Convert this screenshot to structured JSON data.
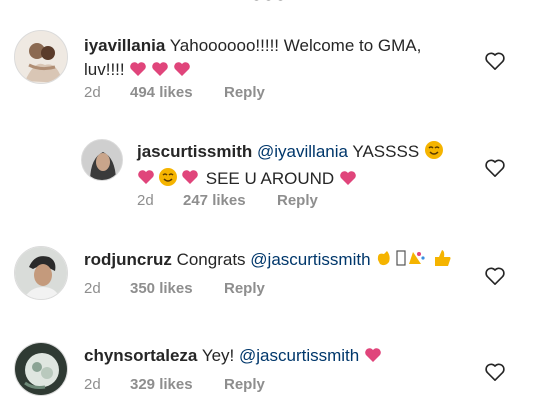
{
  "comments": [
    {
      "username": "iyavillania",
      "text_line1": "Yahoooooo!!!!! Welcome to GMA,",
      "text_line2": "luv!!!!",
      "time": "2d",
      "likes": "494 likes",
      "reply": "Reply"
    },
    {
      "username": "jascurtissmith",
      "mention": "@iyavillania",
      "text_line1": "YASSSS",
      "text_line2": "SEE U AROUND",
      "time": "2d",
      "likes": "247 likes",
      "reply": "Reply"
    },
    {
      "username": "rodjuncruz",
      "text": "Congrats",
      "mention": "@jascurtissmith",
      "time": "2d",
      "likes": "350 likes",
      "reply": "Reply"
    },
    {
      "username": "chynsortaleza",
      "text": "Yey!",
      "mention": "@jascurtissmith",
      "time": "2d",
      "likes": "329 likes",
      "reply": "Reply"
    }
  ],
  "icons": {
    "heart_emoji_color": "#e0457b",
    "smile_emoji_color": "#f5b400",
    "like_outline": "heart-outline-icon"
  }
}
